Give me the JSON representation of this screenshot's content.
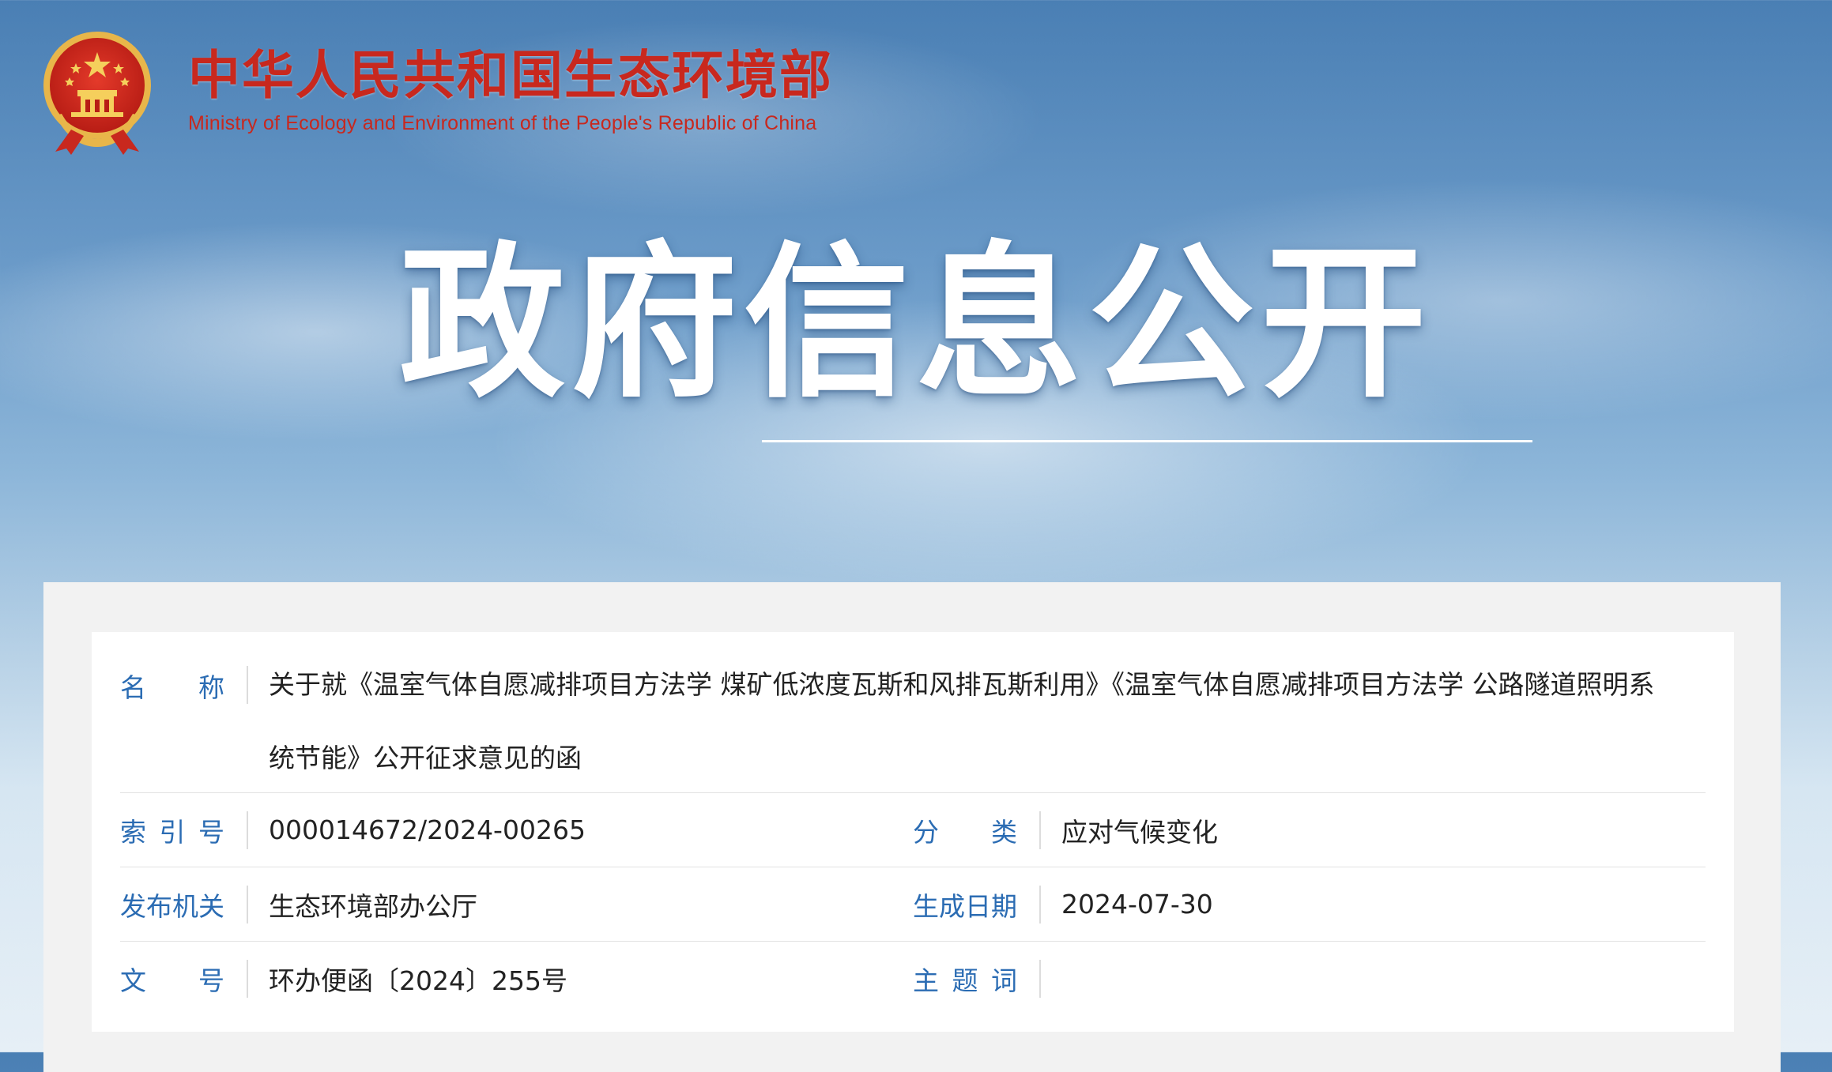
{
  "header": {
    "name_cn": "中华人民共和国生态环境部",
    "name_en": "Ministry of Ecology and Environment of the People's Republic of China"
  },
  "banner": {
    "title": "政府信息公开"
  },
  "info": {
    "name_label": [
      "名",
      "称"
    ],
    "name_value": "关于就《温室气体自愿减排项目方法学 煤矿低浓度瓦斯和风排瓦斯利用》《温室气体自愿减排项目方法学 公路隧道照明系统节能》公开征求意见的函",
    "index_label": [
      "索",
      "引",
      "号"
    ],
    "index_value": "000014672/2024-00265",
    "category_label": [
      "分",
      "类"
    ],
    "category_value": "应对气候变化",
    "issuer_label": "发布机关",
    "issuer_value": "生态环境部办公厅",
    "date_label": "生成日期",
    "date_value": "2024-07-30",
    "docno_label": [
      "文",
      "号"
    ],
    "docno_value": "环办便函〔2024〕255号",
    "subject_label": [
      "主",
      "题",
      "词"
    ],
    "subject_value": ""
  },
  "colors": {
    "brand_red": "#c8281e",
    "label_blue": "#2b6cb3"
  }
}
